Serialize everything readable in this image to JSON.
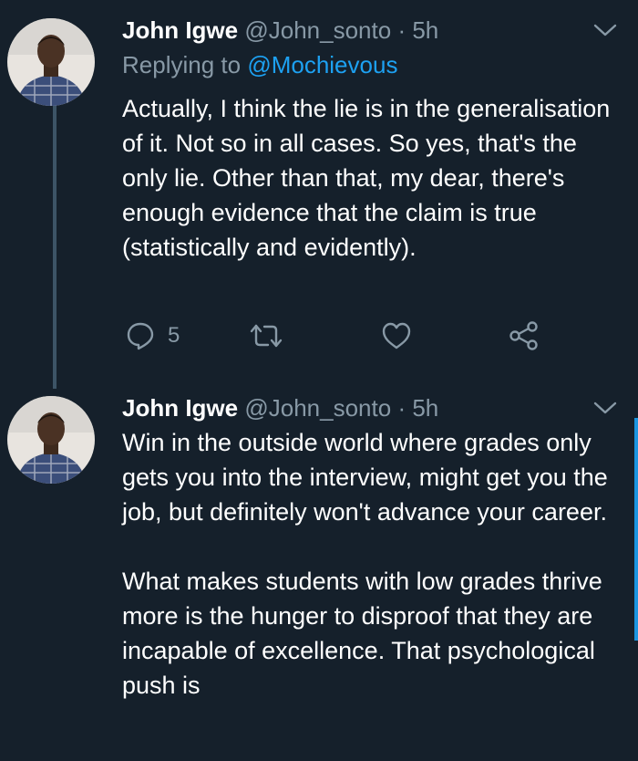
{
  "tweets": [
    {
      "author_name": "John Igwe",
      "handle": "@John_sonto",
      "separator": "·",
      "time": "5h",
      "replying_to_prefix": "Replying to ",
      "replying_to_mention": "@Mochievous",
      "text": "Actually, I think the lie is in the generalisation of it. Not so in all cases. So yes, that's the only lie. Other than that, my dear, there's enough evidence that the claim is true (statistically and evidently).",
      "reply_count": "5",
      "icons": [
        "chevron-down-icon",
        "reply-icon",
        "retweet-icon",
        "like-icon",
        "share-icon"
      ]
    },
    {
      "author_name": "John Igwe",
      "handle": "@John_sonto",
      "separator": "·",
      "time": "5h",
      "text": "Win in the outside world where grades only gets you into the interview, might get you the job, but definitely won't advance your career.\n\nWhat makes students with low grades thrive more is the hunger to disproof that they are incapable of excellence. That psychological push is",
      "icons": [
        "chevron-down-icon"
      ]
    }
  ],
  "colors": {
    "background": "#15202b",
    "primary_text": "#ffffff",
    "secondary_text": "#8899a6",
    "link": "#1da1f2",
    "thread_line": "#3d5466"
  }
}
